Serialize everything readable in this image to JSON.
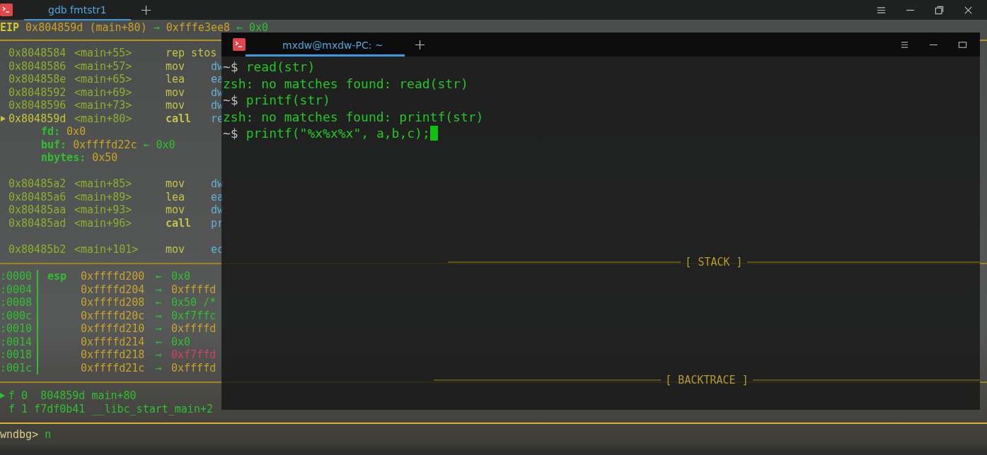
{
  "gdb_window": {
    "tab": {
      "label": "gdb fmtstr1",
      "selected": true
    },
    "registers": {
      "name": "EIP",
      "address": "0x804859d",
      "symbol": "(main+80)",
      "arrow1": "→",
      "target": "0xfffe3ee8",
      "arrow2": "←",
      "value": "0x0"
    },
    "disasm": [
      {
        "address": "0x8048584",
        "symbol": "<main+55>",
        "op": "rep stos",
        "current": false
      },
      {
        "address": "0x8048586",
        "symbol": "<main+57>",
        "op": "mov",
        "arg": "dw",
        "current": false
      },
      {
        "address": "0x804858e",
        "symbol": "<main+65>",
        "op": "lea",
        "arg": "ea",
        "current": false
      },
      {
        "address": "0x8048592",
        "symbol": "<main+69>",
        "op": "mov",
        "arg": "dw",
        "current": false
      },
      {
        "address": "0x8048596",
        "symbol": "<main+73>",
        "op": "mov",
        "arg": "dw",
        "current": false
      },
      {
        "address": "0x804859d",
        "symbol": "<main+80>",
        "op": "call",
        "arg": "re",
        "current": true
      },
      {
        "kind": "param",
        "name": "fd:",
        "value": "0x0"
      },
      {
        "kind": "param",
        "name": "buf:",
        "value": "0xffffd22c",
        "arrow": "←",
        "target": "0x0"
      },
      {
        "kind": "param",
        "name": "nbytes:",
        "value": "0x50"
      },
      {
        "kind": "gap"
      },
      {
        "address": "0x80485a2",
        "symbol": "<main+85>",
        "op": "mov",
        "arg": "dw",
        "current": false
      },
      {
        "address": "0x80485a6",
        "symbol": "<main+89>",
        "op": "lea",
        "arg": "ea",
        "current": false
      },
      {
        "address": "0x80485aa",
        "symbol": "<main+93>",
        "op": "mov",
        "arg": "dw",
        "current": false
      },
      {
        "address": "0x80485ad",
        "symbol": "<main+96>",
        "op": "call",
        "arg": "pr",
        "current": false
      },
      {
        "kind": "gap"
      },
      {
        "address": "0x80485b2",
        "symbol": "<main+101>",
        "op": "mov",
        "arg": "ec",
        "current": false
      }
    ],
    "stack_label": "[ STACK ]",
    "stack": [
      {
        "offset": ":0000",
        "register": "esp",
        "address": "0xffffd200",
        "arrow": "←",
        "value": "0x0",
        "color": "#2fbf2f"
      },
      {
        "offset": ":0004",
        "address": "0xffffd204",
        "arrow": "→",
        "value": "0xffffd",
        "color": "#c9a227"
      },
      {
        "offset": ":0008",
        "address": "0xffffd208",
        "arrow": "←",
        "value": "0x50 /*",
        "color": "#2fbf2f"
      },
      {
        "offset": ":000c",
        "address": "0xffffd20c",
        "arrow": "→",
        "value": "0xf7ffc",
        "color": "#2fbf2f"
      },
      {
        "offset": ":0010",
        "address": "0xffffd210",
        "arrow": "→",
        "value": "0xffffd",
        "color": "#c9a227"
      },
      {
        "offset": ":0014",
        "address": "0xffffd214",
        "arrow": "←",
        "value": "0x0",
        "color": "#2fbf2f"
      },
      {
        "offset": ":0018",
        "address": "0xffffd218",
        "arrow": "→",
        "value": "0xf7ffd",
        "color": "#d0406a"
      },
      {
        "offset": ":001c",
        "address": "0xffffd21c",
        "arrow": "→",
        "value": "0xffffd",
        "color": "#c9a227"
      }
    ],
    "backtrace_label": "[ BACKTRACE ]",
    "backtrace": [
      {
        "text": "f 0  804859d main+80",
        "current": true
      },
      {
        "text": "f 1 f7df0b41 __libc_start_main+2",
        "current": false
      }
    ],
    "prompt": "wndbg>",
    "command": "n"
  },
  "zsh_window": {
    "tab": {
      "label": "mxdw@mxdw-PC: ~",
      "selected": true
    },
    "lines": [
      {
        "kind": "command",
        "prompt": "~$",
        "text": "read(str)",
        "cursor": false
      },
      {
        "kind": "output",
        "text": "zsh: no matches found: read(str)"
      },
      {
        "kind": "command",
        "prompt": "~$",
        "text": "printf(str)",
        "cursor": false
      },
      {
        "kind": "output",
        "text": "zsh: no matches found: printf(str)"
      },
      {
        "kind": "command",
        "prompt": "~$",
        "text": "printf(\"%x%x%x\", a,b,c);",
        "cursor": true
      }
    ]
  }
}
